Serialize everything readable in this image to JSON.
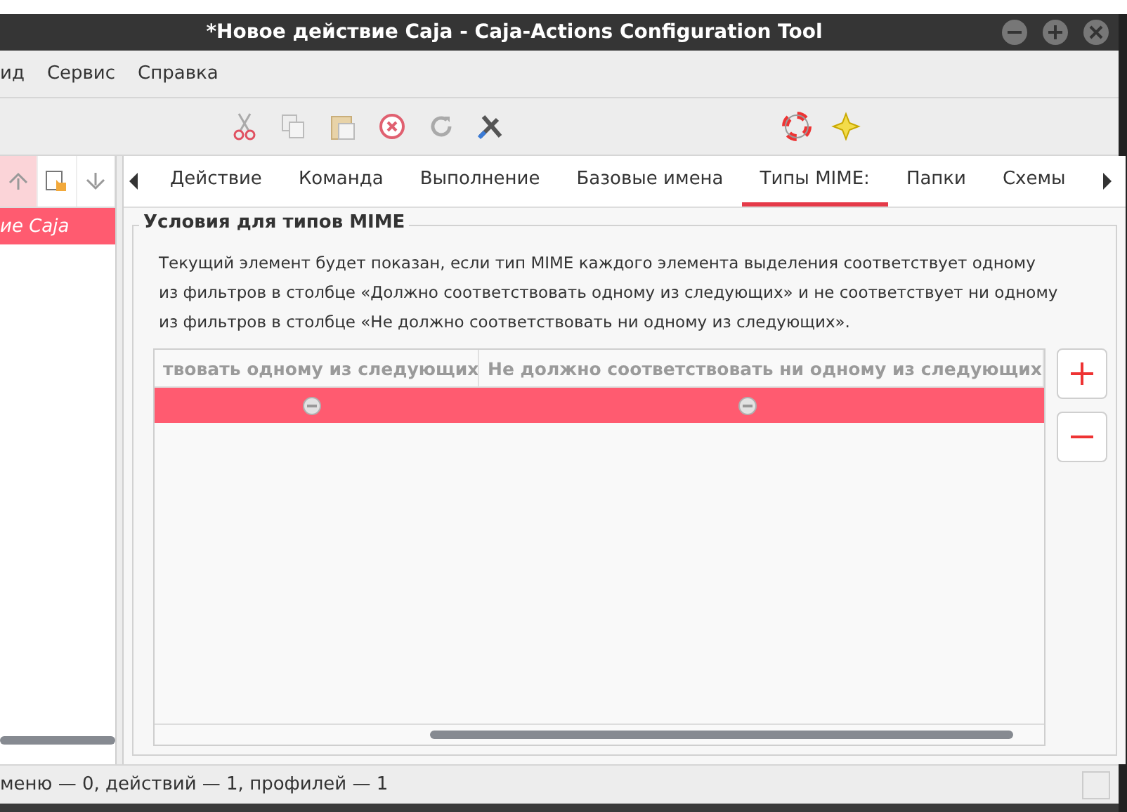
{
  "window": {
    "title": "*Новое действие Caja - Caja-Actions Configuration Tool"
  },
  "menu": [
    "ид",
    "Сервис",
    "Справка"
  ],
  "sidebar": {
    "items": [
      {
        "label": "ие Caja",
        "selected": true
      }
    ]
  },
  "tabs": [
    {
      "label": "Действие",
      "selected": false
    },
    {
      "label": "Команда",
      "selected": false
    },
    {
      "label": "Выполнение",
      "selected": false
    },
    {
      "label": "Базовые имена",
      "selected": false
    },
    {
      "label": "Типы MIME:",
      "selected": true
    },
    {
      "label": "Папки",
      "selected": false
    },
    {
      "label": "Схемы",
      "selected": false
    }
  ],
  "section": {
    "title": "Условия для типов MIME",
    "description": "Текущий элемент будет показан, если тип MIME каждого элемента выделения соответствует одному из фильтров в столбце «Должно соответствовать одному из следующих» и не соответствует ни одному из фильтров в столбце «Не должно соответствовать ни одному из следующих».",
    "table": {
      "columns": [
        "твовать одному из следующих",
        "Не должно соответствовать ни одному из следующих"
      ],
      "rows": [
        {
          "selected": true
        }
      ]
    }
  },
  "status_bar": "меню — 0, действий — 1, профилей — 1"
}
